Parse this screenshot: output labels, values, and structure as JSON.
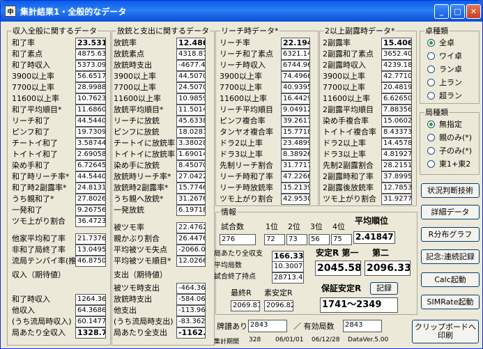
{
  "window": {
    "title": "集計結果1・全般的なデータ",
    "icon": "mahjong-tile-icon",
    "minimize": "_",
    "maximize": "□",
    "close": "✕"
  },
  "g1": {
    "title": "収入全般に関するデータ",
    "rows": [
      {
        "label": "和了率",
        "value": "23.531",
        "bold": true
      },
      {
        "label": "和了素点",
        "value": "4875.63"
      },
      {
        "label": "和了時収入",
        "value": "5373.09"
      },
      {
        "label": "3900以上率",
        "value": "56.6517"
      },
      {
        "label": "7700以上率",
        "value": "28.9988"
      },
      {
        "label": "11600以上率",
        "value": "10.7623"
      },
      {
        "label": "和了平均順目*",
        "value": "11.6860"
      },
      {
        "label": "リーチ和了",
        "value": "44.5440"
      },
      {
        "label": "ピンフ和了",
        "value": "19.7309"
      },
      {
        "label": "チートイ和了",
        "value": "3.58744"
      },
      {
        "label": "トイトイ和了",
        "value": "2.69058"
      },
      {
        "label": "染め手和了",
        "value": "6.72645"
      },
      {
        "label": "和了時リーチ率*",
        "value": "44.5440"
      },
      {
        "label": "和了時2副露率*",
        "value": "24.8131"
      },
      {
        "label": "うち親和了*",
        "value": "27.8026"
      },
      {
        "label": "一発和了",
        "value": "9.26756"
      },
      {
        "label": "ツモ上がり割合",
        "value": "36.4723"
      }
    ],
    "rows2": [
      {
        "label": "他家平均和了率",
        "value": "21.7376"
      },
      {
        "label": "非和了局終了率",
        "value": "13.0495"
      },
      {
        "label": "流局テンパイ率(推)",
        "value": "46.8750"
      }
    ],
    "expected_title": "収入（期待値）",
    "rows3": [
      {
        "label": "和了時収入",
        "value": "1264.36"
      },
      {
        "label": "他収入",
        "value": "64.3686"
      },
      {
        "label": "(うち流局時収入)",
        "value": "60.1477"
      },
      {
        "label": "局あたり全収入",
        "value": "1328.73",
        "bold": true
      }
    ]
  },
  "g2": {
    "title": "放銃と支出に関するデータ",
    "rows": [
      {
        "label": "放銃率",
        "value": "12.486",
        "bold": true
      },
      {
        "label": "放銃素点",
        "value": "4318.87"
      },
      {
        "label": "放銃時支出",
        "value": "-4677.4"
      },
      {
        "label": "3900以上率",
        "value": "44.5070"
      },
      {
        "label": "7700以上率",
        "value": "24.5070"
      },
      {
        "label": "11600以上率",
        "value": "10.9859"
      },
      {
        "label": "放銃平均順目*",
        "value": "11.5014"
      },
      {
        "label": "リーチに放銃",
        "value": "45.6338"
      },
      {
        "label": "ピンフに放銃",
        "value": "18.0281"
      },
      {
        "label": "チートイに放銃率",
        "value": "3.38028"
      },
      {
        "label": "トイトイに放銃率",
        "value": "1.69014"
      },
      {
        "label": "染め手に放銃",
        "value": "8.45070"
      },
      {
        "label": "放銃時リーチ率*",
        "value": "27.0422"
      },
      {
        "label": "放銃時2副露率*",
        "value": "15.7746"
      },
      {
        "label": "うち親へ放銃*",
        "value": "31.2676"
      },
      {
        "label": "一発放銃",
        "value": "6.19718"
      }
    ],
    "rows2": [
      {
        "label": "被ツモ率",
        "value": "22.4762"
      },
      {
        "label": "親かぶり割合",
        "value": "26.4476"
      },
      {
        "label": "平均被ツモ失点",
        "value": "-2066.0"
      },
      {
        "label": "平均被ツモ順目*",
        "value": "12.0266"
      }
    ],
    "expected_title": "支出（期待値）",
    "rows3": [
      {
        "label": "被ツモ時支出",
        "value": "-464.36"
      },
      {
        "label": "放銃時支出",
        "value": "-584.06"
      },
      {
        "label": "他支出",
        "value": "-113.96"
      },
      {
        "label": "(うち流局時支出)",
        "value": "-83.362"
      },
      {
        "label": "局あたり全支出",
        "value": "-1162.3",
        "bold": true
      }
    ]
  },
  "g3": {
    "title": "リーチ時データ*",
    "rows": [
      {
        "label": "リーチ率",
        "value": "22.194",
        "bold": true
      },
      {
        "label": "リーチ和了素点",
        "value": "6321.14"
      },
      {
        "label": "リーチ時収入",
        "value": "6744.96"
      },
      {
        "label": "3900以上率",
        "value": "74.4966"
      },
      {
        "label": "7700以上率",
        "value": "40.9395"
      },
      {
        "label": "11600以上率",
        "value": "16.4429"
      },
      {
        "label": "リーチ平均順目",
        "value": "9.04912"
      },
      {
        "label": "ピンフ複合率",
        "value": "39.2617"
      },
      {
        "label": "タンヤオ複合率",
        "value": "15.7718"
      },
      {
        "label": "ドラ2以上率",
        "value": "23.4899"
      },
      {
        "label": "ドラ3以上率",
        "value": "8.38926"
      },
      {
        "label": "先制リーチ割合",
        "value": "31.7717"
      },
      {
        "label": "リーチ時和了率",
        "value": "47.2266"
      },
      {
        "label": "リーチ時放銃率",
        "value": "15.2139"
      },
      {
        "label": "ツモ上がり割合",
        "value": "42.9530"
      }
    ]
  },
  "g4": {
    "title": "2以上副露時データ*",
    "rows": [
      {
        "label": "2副露率",
        "value": "15.406",
        "bold": true
      },
      {
        "label": "2副露和了素点",
        "value": "3652.40"
      },
      {
        "label": "2副露時収入",
        "value": "4239.18"
      },
      {
        "label": "3900以上率",
        "value": "42.7710"
      },
      {
        "label": "7700以上率",
        "value": "20.4819"
      },
      {
        "label": "11600以上率",
        "value": "6.62650"
      },
      {
        "label": "2副露平均順目",
        "value": "7.88356"
      },
      {
        "label": "染め手複合率",
        "value": "15.0602"
      },
      {
        "label": "トイトイ複合率",
        "value": "8.43373"
      },
      {
        "label": "ドラ2以上率",
        "value": "14.4578"
      },
      {
        "label": "ドラ3以上率",
        "value": "4.81927"
      },
      {
        "label": "先制2副露割合",
        "value": "28.2151"
      },
      {
        "label": "2副露時和了率",
        "value": "37.8995"
      },
      {
        "label": "2副露後放銃率",
        "value": "12.7853"
      },
      {
        "label": "ツモ上がり割合",
        "value": "31.9277"
      }
    ]
  },
  "table": {
    "title": "卓種類",
    "options": [
      "全卓",
      "ワイ卓",
      "ラン卓",
      "上ラン",
      "超ラン"
    ],
    "selected": 0
  },
  "round": {
    "title": "局種類",
    "options": [
      "無指定",
      "親のみ(*)",
      "子のみ(*)",
      "東1+東2"
    ],
    "selected": 0
  },
  "buttons": {
    "situation": "状況判断技術",
    "detail": "詳細データ",
    "rdist": "R分布グラフ",
    "record": "記念:連続記録",
    "calc": "Calc起動",
    "simrate": "SIMRate起動",
    "clipboard": "クリップボードへ",
    "print": "印刷"
  },
  "info": {
    "title": "情報",
    "games_label": "試合数",
    "games": "276",
    "ranks": [
      "1位",
      "2位",
      "3位",
      "4位"
    ],
    "rank_counts": [
      "72",
      "73",
      "56",
      "75"
    ],
    "avg_rank_label": "平均順位",
    "avg_rank": "2.41847",
    "balance_label": "局あたり全収支",
    "balance": "166.338",
    "avg_rounds_label": "平均局数",
    "avg_rounds": "10.30072",
    "avg_points_label": "試合終了持点",
    "avg_points": "28713.40",
    "stable_first_label": "安定R 第一",
    "stable_first": "2045.58",
    "stable_second_label": "第二",
    "stable_second": "2096.33",
    "final_r_label": "最終R",
    "final_r": "2069.87",
    "best_r_label": "素安定R",
    "best_r": "2096.82",
    "guarantee_label": "保証安定R",
    "record_btn": "記録",
    "guarantee": "1741～2349"
  },
  "footer": {
    "with_record_label": "牌譜あり",
    "with_record": "2843",
    "valid_label": "／ 有効局数",
    "valid": "2843",
    "period_label": "集計期間",
    "period_count": "328",
    "date_from": "06/01/01",
    "date_to": "06/12/28",
    "version": "DataVer.5.00"
  }
}
